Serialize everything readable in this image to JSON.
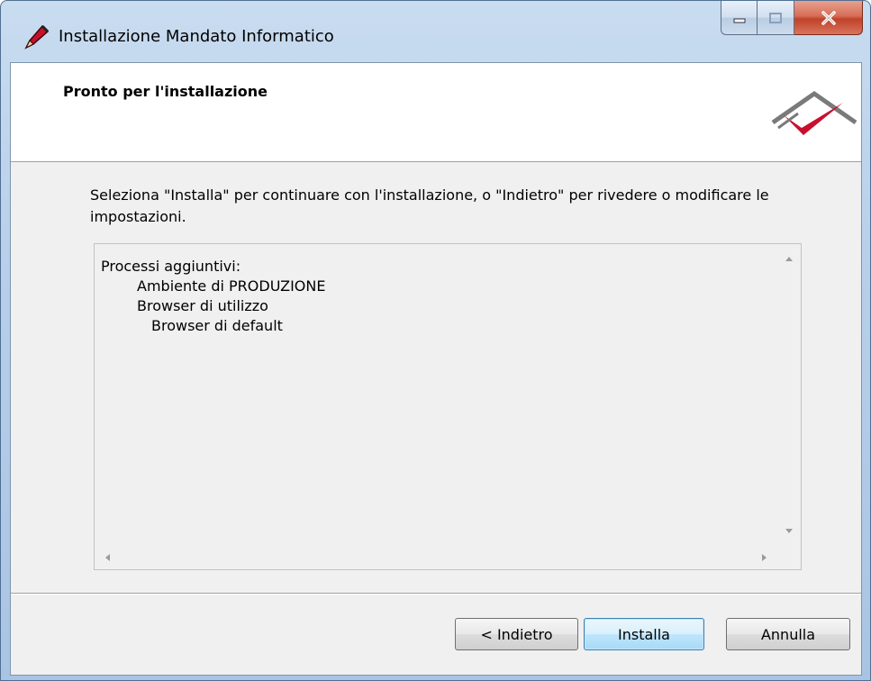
{
  "window": {
    "title": "Installazione Mandato Informatico",
    "icon": "pen-icon"
  },
  "header": {
    "title": "Pronto per l'installazione",
    "logo": "checkmark-logo"
  },
  "description": "Seleziona \"Installa\" per continuare con l'installazione, o \"Indietro\" per rivedere o modificare le impostazioni.",
  "summary_list": {
    "lines": [
      {
        "text": "Processi aggiuntivi:",
        "indent": 0
      },
      {
        "text": "Ambiente di PRODUZIONE",
        "indent": 1
      },
      {
        "text": "Browser di utilizzo",
        "indent": 1
      },
      {
        "text": "Browser di default",
        "indent": 2
      }
    ]
  },
  "buttons": {
    "back": "< Indietro",
    "install": "Installa",
    "cancel": "Annulla"
  },
  "colors": {
    "client_bg": "#f0f0f0",
    "header_bg": "#ffffff",
    "logo_red": "#c8102e",
    "logo_gray": "#7a7a7a",
    "default_button_border": "#3c7fb1"
  }
}
